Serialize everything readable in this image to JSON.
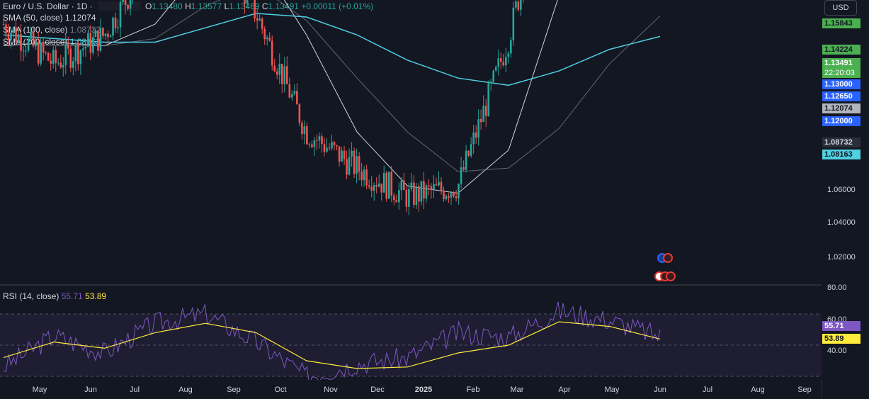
{
  "legend": {
    "title": "Euro / U.S. Dollar · 1D ·",
    "ohlc": {
      "o_label": "O",
      "o": "1.13480",
      "h_label": "H",
      "h": "1.13577",
      "l_label": "L",
      "l": "1.13469",
      "c_label": "C",
      "c": "1.13491",
      "change": "+0.00011 (+0.01%)"
    },
    "sma50": {
      "label": "SMA (50, close)",
      "value": "1.12074"
    },
    "sma100": {
      "label": "SMA (100, close)",
      "value": "1.08732"
    },
    "sma200": {
      "label": "SMA (200, close)",
      "value": "1.08163"
    },
    "rsi": {
      "label": "RSI (14, close)",
      "value": "55.71",
      "ma_value": "53.89"
    }
  },
  "currency_button": "USD",
  "countdown": "22:20:03",
  "price_axis_labels": [
    "1.06000",
    "1.04000",
    "1.02000"
  ],
  "price_tags": [
    {
      "text": "1.15843",
      "bg": "#4caf50",
      "fg": "#131722"
    },
    {
      "text": "1.14224",
      "bg": "#4caf50",
      "fg": "#131722"
    },
    {
      "text": "1.13491",
      "bg": "#4caf50",
      "fg": "#ffffff"
    },
    {
      "text": "1.13000",
      "bg": "#2962ff",
      "fg": "#ffffff"
    },
    {
      "text": "1.12650",
      "bg": "#2962ff",
      "fg": "#ffffff"
    },
    {
      "text": "1.12074",
      "bg": "#b2b5be",
      "fg": "#131722"
    },
    {
      "text": "1.12000",
      "bg": "#2962ff",
      "fg": "#ffffff"
    },
    {
      "text": "1.08732",
      "bg": "#2a2e39",
      "fg": "#d1d4dc"
    },
    {
      "text": "1.08163",
      "bg": "#4dd0e1",
      "fg": "#131722"
    }
  ],
  "rsi_axis_labels": [
    "80.00",
    "60.00",
    "40.00"
  ],
  "rsi_tags": [
    {
      "text": "55.71",
      "bg": "#7e57c2",
      "fg": "#ffffff"
    },
    {
      "text": "53.89",
      "bg": "#ffeb3b",
      "fg": "#131722"
    }
  ],
  "time_labels": [
    "May",
    "Jun",
    "Jul",
    "Aug",
    "Sep",
    "Oct",
    "Nov",
    "Dec",
    "2025",
    "Feb",
    "Mar",
    "Apr",
    "May",
    "Jun",
    "Jul",
    "Aug",
    "Sep"
  ],
  "colors": {
    "up": "#26a69a",
    "down": "#ef5350",
    "sma50": "#d1d4dc",
    "sma100": "#787b86",
    "sma200": "#4dd0e1",
    "rsi": "#7e57c2",
    "rsi_ma": "#ffeb3b",
    "level_green": "#4caf50",
    "level_blue": "#2962ff"
  },
  "chart_data": [
    {
      "type": "line",
      "title": "Euro / U.S. Dollar · 1D",
      "x": [
        "2024-05",
        "2024-06",
        "2024-07",
        "2024-08",
        "2024-09",
        "2024-10",
        "2024-11",
        "2024-12",
        "2025-01",
        "2025-02",
        "2025-03",
        "2025-04",
        "2025-05",
        "2025-06"
      ],
      "series": [
        {
          "name": "Close",
          "values": [
            1.085,
            1.074,
            1.082,
            1.105,
            1.113,
            1.088,
            1.055,
            1.045,
            1.037,
            1.04,
            1.081,
            1.138,
            1.133,
            1.1349
          ]
        },
        {
          "name": "SMA (50, close)",
          "values": [
            1.079,
            1.08,
            1.079,
            1.085,
            1.102,
            1.104,
            1.082,
            1.055,
            1.04,
            1.038,
            1.05,
            1.093,
            1.115,
            1.1207
          ]
        },
        {
          "name": "SMA (100, close)",
          "values": [
            1.08,
            1.079,
            1.079,
            1.081,
            1.09,
            1.096,
            1.086,
            1.07,
            1.055,
            1.044,
            1.045,
            1.056,
            1.074,
            1.0873
          ]
        },
        {
          "name": "SMA (200, close)",
          "values": [
            1.082,
            1.081,
            1.08,
            1.08,
            1.084,
            1.088,
            1.087,
            1.082,
            1.075,
            1.07,
            1.068,
            1.072,
            1.078,
            1.0816
          ]
        }
      ],
      "levels": [
        1.15843,
        1.14224,
        1.13,
        1.1265,
        1.12
      ],
      "ylim": [
        1.01,
        1.165
      ],
      "grid": false
    },
    {
      "type": "line",
      "title": "RSI (14, close)",
      "x": [
        "2024-05",
        "2024-06",
        "2024-07",
        "2024-08",
        "2024-09",
        "2024-10",
        "2024-11",
        "2024-12",
        "2025-01",
        "2025-02",
        "2025-03",
        "2025-04",
        "2025-05",
        "2025-06"
      ],
      "series": [
        {
          "name": "RSI",
          "values": [
            36,
            56,
            45,
            64,
            70,
            52,
            30,
            38,
            42,
            58,
            55,
            72,
            66,
            55.71
          ]
        },
        {
          "name": "RSI MA",
          "values": [
            42,
            52,
            48,
            58,
            64,
            58,
            40,
            35,
            36,
            45,
            50,
            65,
            62,
            53.89
          ]
        }
      ],
      "ylim": [
        20,
        80
      ],
      "bands": [
        70,
        50,
        30
      ]
    }
  ]
}
